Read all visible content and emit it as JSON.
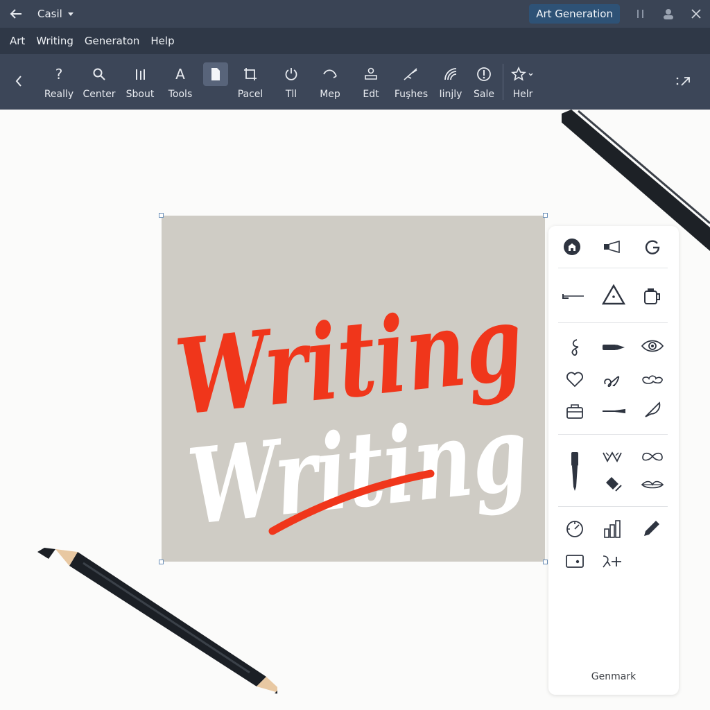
{
  "titlebar": {
    "doc_name": "Casil",
    "mode_button": "Art Generation",
    "icons": [
      "back-arrow-icon",
      "chevron-down-icon",
      "pause-icon",
      "user-icon",
      "close-icon"
    ]
  },
  "menu": [
    "Art",
    "Writing",
    "Generaton",
    "Help"
  ],
  "toolbar": {
    "tools": [
      {
        "label": "Really",
        "icon": "help-icon"
      },
      {
        "label": "Center",
        "icon": "search-icon"
      },
      {
        "label": "Sbout",
        "icon": "bars-icon"
      },
      {
        "label": "Tools",
        "icon": "text-icon"
      },
      {
        "label": "",
        "icon": "document-icon"
      },
      {
        "label": "Pacel",
        "icon": "crop-icon"
      },
      {
        "label": "Tll",
        "icon": "power-icon"
      },
      {
        "label": "Mep",
        "icon": "undo-icon"
      },
      {
        "label": "Edt",
        "icon": "stamp-icon"
      },
      {
        "label": "Fuşhes",
        "icon": "brush-icon"
      },
      {
        "label": "Iinjly",
        "icon": "signal-icon"
      },
      {
        "label": "Sale",
        "icon": "alert-icon"
      },
      {
        "label": "Helr",
        "icon": "star-icon"
      }
    ],
    "expand_icon": "expand-icon"
  },
  "artwork": {
    "top_word": "Writing",
    "bottom_word": "Writing",
    "colors": {
      "red": "#f0361b",
      "white": "#ffffff",
      "background": "#cfccc5"
    }
  },
  "panel": {
    "footer": "Genmark",
    "icons": [
      "home-icon",
      "speaker-icon",
      "google-icon",
      "pen-line-icon",
      "warning-icon",
      "mug-icon",
      "squiggle-icon",
      "marker-icon",
      "eye-icon",
      "heart-icon",
      "loop-icon",
      "cloud-icon",
      "toolbox-icon",
      "knife-icon",
      "quill-icon",
      "paintbrush-icon",
      "crown-icon",
      "mustache-icon",
      "eraser-icon",
      "lips-icon",
      "compass-icon",
      "bar-chart-icon",
      "pencil-icon",
      "wallet-icon",
      "sparkle-plus-icon"
    ]
  }
}
